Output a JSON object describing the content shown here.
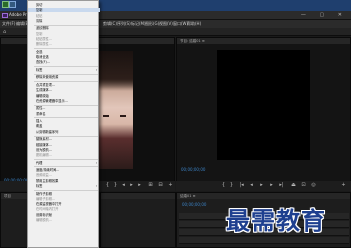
{
  "app": {
    "title": "Adobe Prem",
    "window_controls": "— ▢ ✕"
  },
  "menubar": [
    "文件(F)",
    "编辑(E)",
    "剪辑(C)",
    "序列(S)",
    "标记(M)",
    "图形(G)",
    "视图(V)",
    "窗口(W)",
    "帮助(H)"
  ],
  "program_panel": {
    "header": "节目: 结婚01 ≡",
    "timecode": "00;00;00;00"
  },
  "source_panel": {
    "timecode": "00;00;00;00"
  },
  "timeline_panel": {
    "header": "结婚01 ≡",
    "timecode": "00;00;00;00"
  },
  "project_panel": {
    "header": "项目"
  },
  "context_menu": {
    "items": [
      {
        "label": "剪切",
        "state": "normal"
      },
      {
        "label": "复制",
        "state": "selected"
      },
      {
        "label": "粘贴",
        "state": "disabled"
      },
      {
        "label": "清除",
        "state": "normal"
      },
      {
        "label": "波纹删除",
        "state": "normal"
      },
      {
        "label": "复制",
        "state": "disabled"
      },
      {
        "label": "粘贴属性...",
        "state": "disabled"
      },
      {
        "label": "删除属性...",
        "state": "disabled"
      },
      {
        "label": "全选",
        "state": "normal"
      },
      {
        "label": "取消全选",
        "state": "normal"
      },
      {
        "label": "查找(F)...",
        "state": "normal"
      },
      {
        "label": "标签",
        "state": "sub"
      },
      {
        "label": "移除未使用资源",
        "state": "normal"
      },
      {
        "label": "合并重复项...",
        "state": "normal"
      },
      {
        "label": "生成媒体...",
        "state": "normal"
      },
      {
        "label": "编辑原始",
        "state": "normal"
      },
      {
        "label": "在资源管理器中显示...",
        "state": "normal"
      },
      {
        "label": "属性...",
        "state": "normal"
      },
      {
        "label": "重命名",
        "state": "normal"
      },
      {
        "label": "插入",
        "state": "normal"
      },
      {
        "label": "覆盖",
        "state": "normal"
      },
      {
        "label": "从剪辑新建序列",
        "state": "normal"
      },
      {
        "label": "替换素材...",
        "state": "normal"
      },
      {
        "label": "链接媒体...",
        "state": "normal"
      },
      {
        "label": "设为脱机...",
        "state": "normal"
      },
      {
        "label": "脱机编辑...",
        "state": "disabled"
      },
      {
        "label": "代理",
        "state": "sub"
      },
      {
        "label": "速度/持续时间...",
        "state": "normal"
      },
      {
        "label": "音频增益...",
        "state": "disabled"
      },
      {
        "label": "禁用主剪辑效果",
        "state": "normal"
      },
      {
        "label": "标签",
        "state": "sub"
      },
      {
        "label": "制作子剪辑",
        "state": "normal"
      },
      {
        "label": "编辑子剪辑...",
        "state": "disabled"
      },
      {
        "label": "在源监视器中打开",
        "state": "normal"
      },
      {
        "label": "在时间轴内打开",
        "state": "disabled"
      },
      {
        "label": "设置标识帧",
        "state": "normal"
      },
      {
        "label": "编辑脱机...",
        "state": "disabled"
      }
    ]
  },
  "watermark": "最需教育"
}
